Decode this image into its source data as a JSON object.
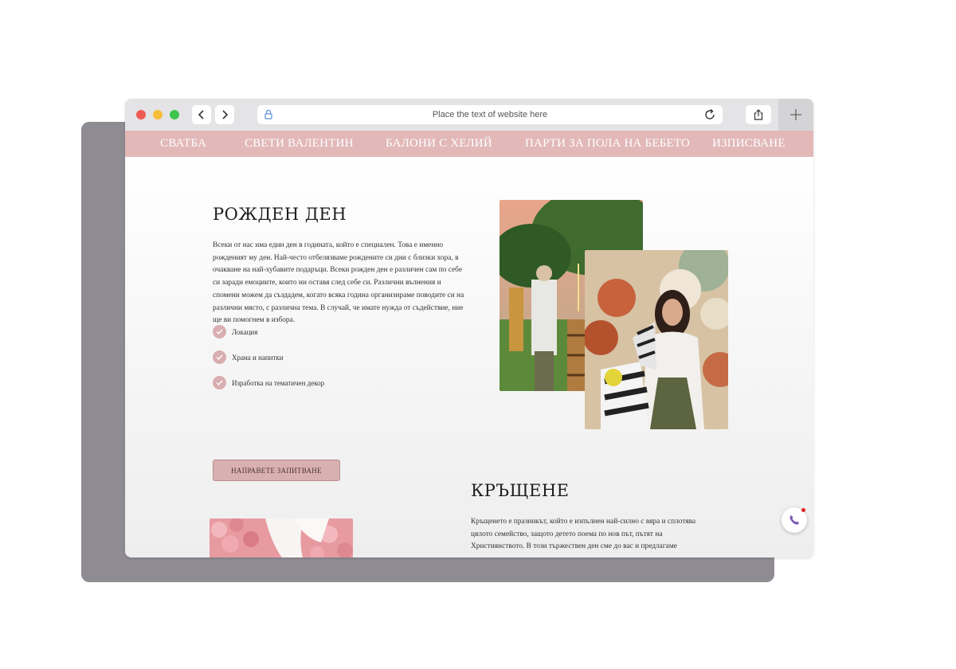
{
  "browser": {
    "address_placeholder": "Place the text of website here",
    "icons": [
      "back-arrow-icon",
      "forward-arrow-icon",
      "lock-icon",
      "reload-icon",
      "share-icon",
      "plus-icon"
    ]
  },
  "nav": {
    "items": [
      "СВАТБА",
      "СВЕТИ ВАЛЕНТИН",
      "БАЛОНИ С ХЕЛИЙ",
      "ПАРТИ ЗА ПОЛА НА БЕБЕТО",
      "ИЗПИСВАНЕ"
    ]
  },
  "birthday": {
    "title": "РОЖДЕН ДЕН",
    "body": "Всеки от нас има един ден в годината, който е специален. Това е именно рожденият му ден. Най-често отбелязваме рождените си дни с близки хора, в очакване на най-хубавите подаръци. Всеки рожден ден е различен сам по себе си заради емоциите, които ни оставя след себе си. Различни вълнения и спомени можем да създадем, когато всяка година организираме поводите си на различни място, с различна тема. В случай, че имате нужда от съдействие, ние ще ви помогнем в избора.",
    "features": [
      "Локация",
      "Храна и напитки",
      "Изработка на тематичен декор"
    ],
    "cta": "НАПРАВЕТЕ ЗАПИТВАНЕ"
  },
  "baptism": {
    "title": "КРЪЩЕНЕ",
    "body": "Кръщенето е празникът, който е изпълнен най-силно с вяра и сплотява цялото семейство, защото детето поема по нов път, пътят на Християнството. В този тържествен ден сме до вас и предлагаме"
  },
  "colors": {
    "nav_bg": "#e2b8b8",
    "accent": "#d9aeb0",
    "shadow": "#8f8b93"
  }
}
